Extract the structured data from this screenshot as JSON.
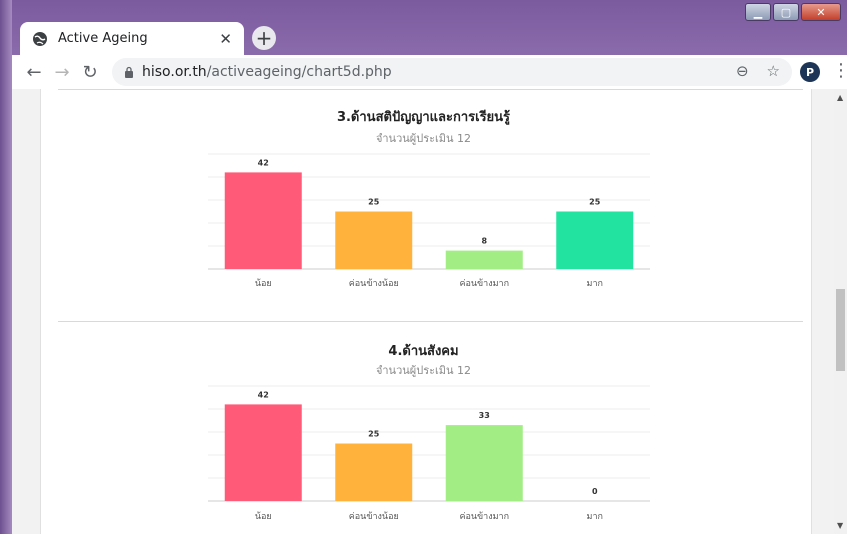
{
  "browser": {
    "tab_title": "Active Ageing",
    "url_host": "hiso.or.th",
    "url_path": "/activeageing/chart5d.php",
    "profile_initial": "P",
    "icons": [
      "globe-icon",
      "close-icon",
      "plus-icon",
      "back-arrow-icon",
      "forward-arrow-icon",
      "reload-icon",
      "lock-icon",
      "zoom-icon",
      "star-icon",
      "menu-dots-icon"
    ]
  },
  "chart_data": [
    {
      "type": "bar",
      "title": "3.ด้านสติปัญญาและการเรียนรู้",
      "subtitle": "จำนวนผู้ประเมิน 12",
      "categories": [
        "น้อย",
        "ค่อนข้างน้อย",
        "ค่อนข้างมาก",
        "มาก"
      ],
      "values": [
        42,
        25,
        8,
        25
      ],
      "colors": [
        "#ff5a77",
        "#ffb33d",
        "#a2ee84",
        "#22e3a0"
      ],
      "ylim": [
        0,
        50
      ],
      "grid": true
    },
    {
      "type": "bar",
      "title": "4.ด้านสังคม",
      "subtitle": "จำนวนผู้ประเมิน 12",
      "categories": [
        "น้อย",
        "ค่อนข้างน้อย",
        "ค่อนข้างมาก",
        "มาก"
      ],
      "values": [
        42,
        25,
        33,
        0
      ],
      "colors": [
        "#ff5a77",
        "#ffb33d",
        "#a2ee84",
        "#22e3a0"
      ],
      "ylim": [
        0,
        50
      ],
      "grid": true
    }
  ]
}
